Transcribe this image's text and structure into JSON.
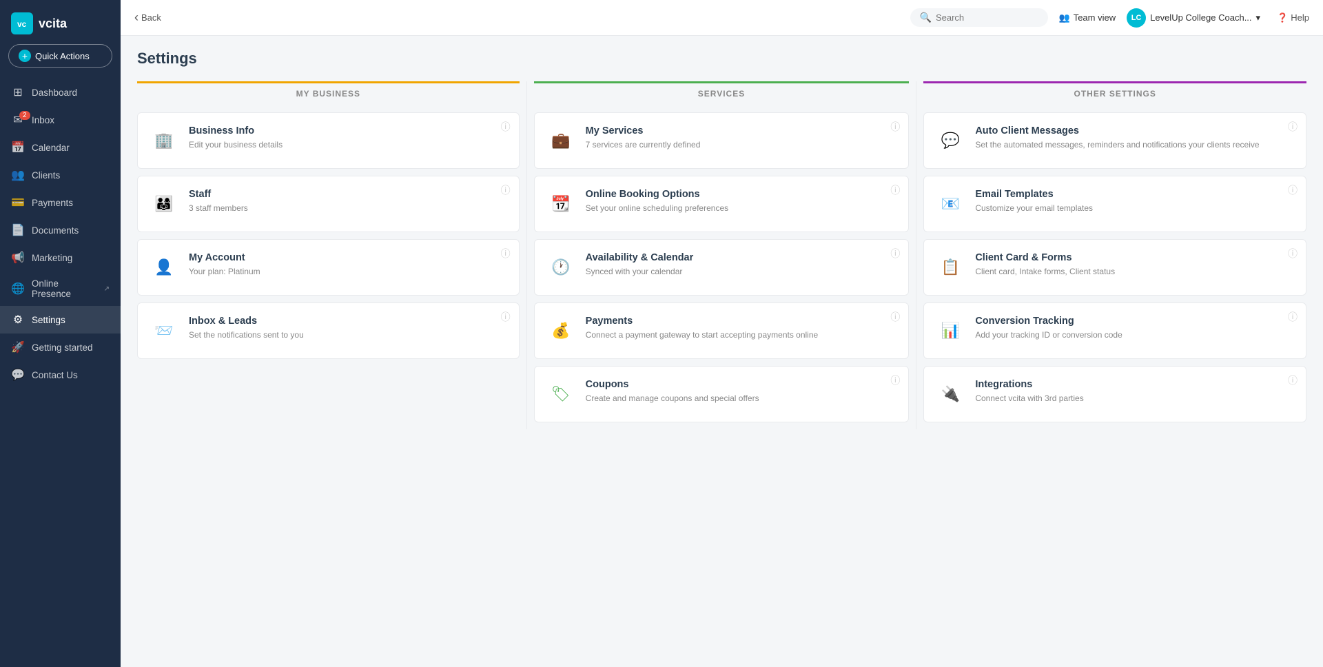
{
  "app": {
    "logo_text": "vcita",
    "logo_abbr": "vc"
  },
  "sidebar": {
    "quick_actions_label": "Quick Actions",
    "nav_items": [
      {
        "id": "dashboard",
        "label": "Dashboard",
        "icon": "⊞",
        "badge": null,
        "active": false
      },
      {
        "id": "inbox",
        "label": "Inbox",
        "icon": "✉",
        "badge": "2",
        "active": false
      },
      {
        "id": "calendar",
        "label": "Calendar",
        "icon": "📅",
        "badge": null,
        "active": false
      },
      {
        "id": "clients",
        "label": "Clients",
        "icon": "👥",
        "badge": null,
        "active": false
      },
      {
        "id": "payments",
        "label": "Payments",
        "icon": "💳",
        "badge": null,
        "active": false
      },
      {
        "id": "documents",
        "label": "Documents",
        "icon": "📄",
        "badge": null,
        "active": false
      },
      {
        "id": "marketing",
        "label": "Marketing",
        "icon": "📢",
        "badge": null,
        "active": false
      },
      {
        "id": "online-presence",
        "label": "Online Presence",
        "icon": "🌐",
        "badge": null,
        "active": false,
        "external": true
      },
      {
        "id": "settings",
        "label": "Settings",
        "icon": "⚙",
        "badge": null,
        "active": true
      },
      {
        "id": "getting-started",
        "label": "Getting started",
        "icon": "🚀",
        "badge": null,
        "active": false
      },
      {
        "id": "contact-us",
        "label": "Contact Us",
        "icon": "💬",
        "badge": null,
        "active": false
      }
    ]
  },
  "topbar": {
    "back_label": "Back",
    "search_placeholder": "Search",
    "team_view_label": "Team view",
    "user_label": "LevelUp College Coach...",
    "help_label": "Help",
    "avatar_initials": "LC"
  },
  "page": {
    "title": "Settings"
  },
  "columns": {
    "my_business": {
      "header": "MY BUSINESS",
      "cards": [
        {
          "id": "business-info",
          "title": "Business Info",
          "desc": "Edit your business details",
          "icon": "🏢"
        },
        {
          "id": "staff",
          "title": "Staff",
          "desc": "3 staff members",
          "icon": "👨‍👩‍👧"
        },
        {
          "id": "my-account",
          "title": "My Account",
          "desc": "Your plan: Platinum",
          "icon": "👤"
        },
        {
          "id": "inbox-leads",
          "title": "Inbox & Leads",
          "desc": "Set the notifications sent to you",
          "icon": "📨"
        }
      ]
    },
    "services": {
      "header": "SERVICES",
      "cards": [
        {
          "id": "my-services",
          "title": "My Services",
          "desc": "7 services are currently defined",
          "icon": "💼"
        },
        {
          "id": "online-booking",
          "title": "Online Booking Options",
          "desc": "Set your online scheduling preferences",
          "icon": "📆"
        },
        {
          "id": "availability-calendar",
          "title": "Availability & Calendar",
          "desc": "Synced with your calendar",
          "icon": "🕐"
        },
        {
          "id": "payments",
          "title": "Payments",
          "desc": "Connect a payment gateway to start accepting payments online",
          "icon": "💰"
        },
        {
          "id": "coupons",
          "title": "Coupons",
          "desc": "Create and manage coupons and special offers",
          "icon": "🏷"
        }
      ]
    },
    "other": {
      "header": "OTHER SETTINGS",
      "cards": [
        {
          "id": "auto-client-messages",
          "title": "Auto Client Messages",
          "desc": "Set the automated messages, reminders and notifications your clients receive",
          "icon": "💬"
        },
        {
          "id": "email-templates",
          "title": "Email Templates",
          "desc": "Customize your email templates",
          "icon": "📧"
        },
        {
          "id": "client-card-forms",
          "title": "Client Card & Forms",
          "desc": "Client card, Intake forms, Client status",
          "icon": "📋"
        },
        {
          "id": "conversion-tracking",
          "title": "Conversion Tracking",
          "desc": "Add your tracking ID or conversion code",
          "icon": "📊"
        },
        {
          "id": "integrations",
          "title": "Integrations",
          "desc": "Connect vcita with 3rd parties",
          "icon": "🔌"
        }
      ]
    }
  }
}
